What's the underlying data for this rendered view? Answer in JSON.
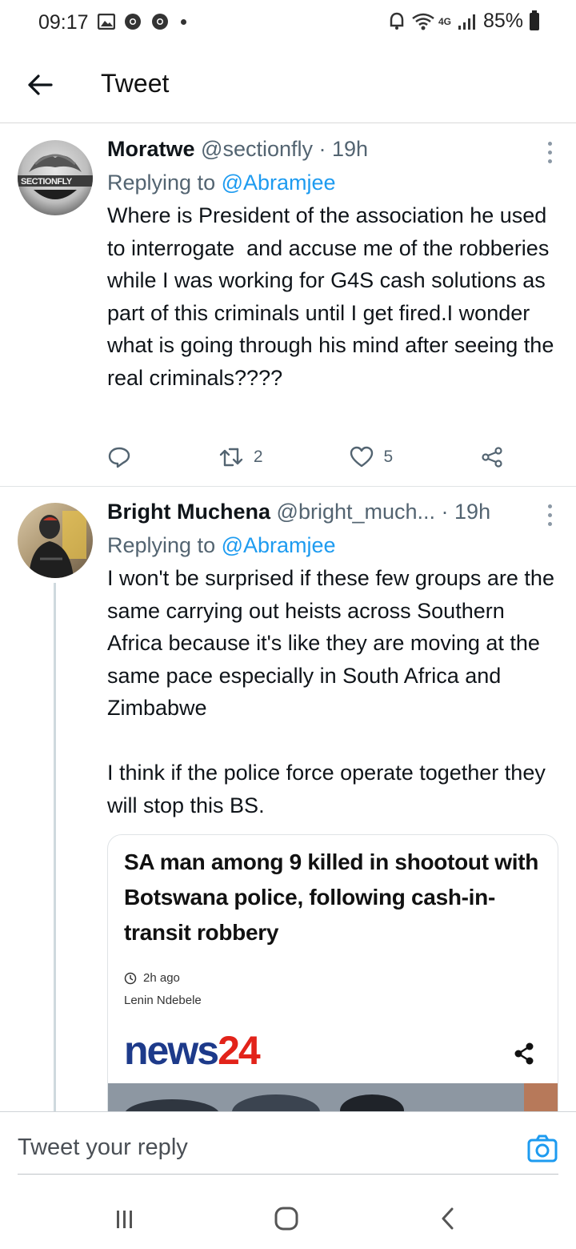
{
  "status_bar": {
    "time": "09:17",
    "network": "4G",
    "battery": "85%"
  },
  "header": {
    "title": "Tweet"
  },
  "tweets": [
    {
      "name": "Moratwe",
      "handle": "@sectionfly",
      "time": "· 19h",
      "avatar_text": "SECTIONFLY",
      "replying_prefix": "Replying to ",
      "replying_to": "@Abramjee",
      "text": "Where is President of the association he used to interrogate  and accuse me of the robberies while I was working for G4S cash solutions as part of this criminals until I get fired.I wonder what is going through his mind after seeing the real criminals????",
      "retweets": "2",
      "likes": "5"
    },
    {
      "name": "Bright Muchena",
      "handle": "@bright_much...",
      "time": "· 19h",
      "replying_prefix": "Replying to ",
      "replying_to": "@Abramjee",
      "text": "I won't be surprised if these few groups are the same carrying out heists across Southern Africa because it's like they are moving at the same pace especially in South Africa and Zimbabwe\n\nI think if the police force operate together they will stop this BS.",
      "card": {
        "title": "SA man among 9 killed in shootout with Botswana police, following cash-in-transit robbery",
        "time": "2h ago",
        "author": "Lenin Ndebele",
        "logo_part1": "news",
        "logo_part2": "24"
      }
    }
  ],
  "reply_bar": {
    "placeholder": "Tweet your reply"
  },
  "colors": {
    "link": "#1d9bf0",
    "muted": "#536471",
    "logo_blue": "#1d3a8a",
    "logo_red": "#e2231a"
  }
}
